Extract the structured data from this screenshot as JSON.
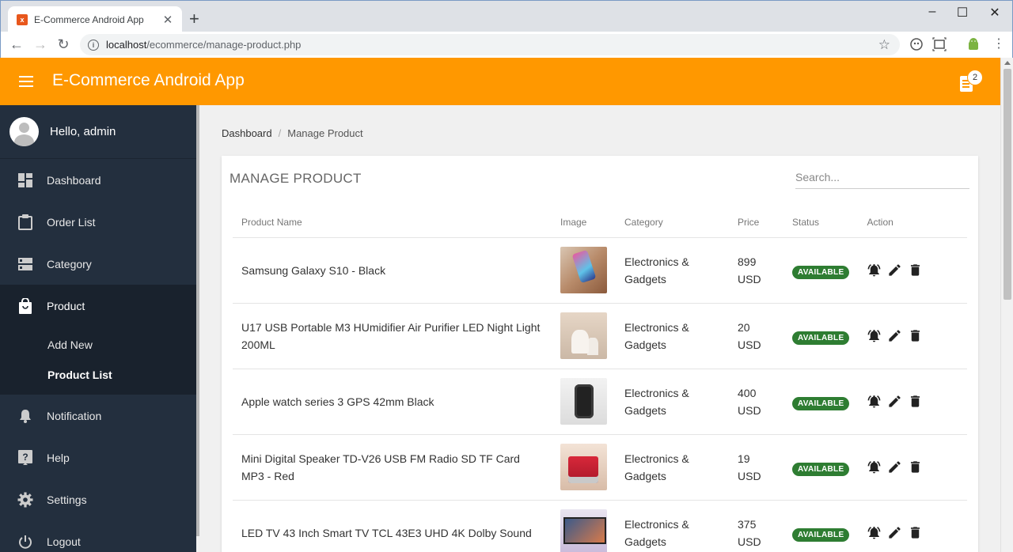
{
  "browser": {
    "tab_title": "E-Commerce Android App",
    "url_host": "localhost",
    "url_path": "/ecommerce/manage-product.php"
  },
  "header": {
    "title": "E-Commerce Android App",
    "notification_count": "2",
    "color": "#ff9800"
  },
  "sidebar": {
    "greeting": "Hello, admin",
    "items": [
      {
        "label": "Dashboard",
        "icon": "dashboard-icon"
      },
      {
        "label": "Order List",
        "icon": "clipboard-icon"
      },
      {
        "label": "Category",
        "icon": "category-icon"
      },
      {
        "label": "Product",
        "icon": "shopping-bag-icon"
      },
      {
        "label": "Notification",
        "icon": "bell-icon"
      },
      {
        "label": "Help",
        "icon": "help-icon"
      },
      {
        "label": "Settings",
        "icon": "gear-icon"
      },
      {
        "label": "Logout",
        "icon": "power-icon"
      }
    ],
    "submenu": [
      {
        "label": "Add New"
      },
      {
        "label": "Product List"
      }
    ],
    "background": "#232f3e"
  },
  "breadcrumb": {
    "root": "Dashboard",
    "separator": "/",
    "current": "Manage Product"
  },
  "card": {
    "title": "MANAGE PRODUCT",
    "search_placeholder": "Search..."
  },
  "table": {
    "headers": {
      "name": "Product Name",
      "image": "Image",
      "category": "Category",
      "price": "Price",
      "status": "Status",
      "action": "Action"
    },
    "rows": [
      {
        "name": "Samsung Galaxy S10 - Black",
        "image": "phone-thumbnail",
        "category_line1": "Electronics &",
        "category_line2": "Gadgets",
        "price_value": "899",
        "price_currency": "USD",
        "status": "AVAILABLE"
      },
      {
        "name": "U17 USB Portable M3 HUmidifier Air Purifier LED Night Light 200ML",
        "image": "humidifier-thumbnail",
        "category_line1": "Electronics &",
        "category_line2": "Gadgets",
        "price_value": "20",
        "price_currency": "USD",
        "status": "AVAILABLE"
      },
      {
        "name": "Apple watch series 3 GPS 42mm Black",
        "image": "watch-thumbnail",
        "category_line1": "Electronics &",
        "category_line2": "Gadgets",
        "price_value": "400",
        "price_currency": "USD",
        "status": "AVAILABLE"
      },
      {
        "name": "Mini Digital Speaker TD-V26 USB FM Radio SD TF Card MP3 - Red",
        "image": "speaker-thumbnail",
        "category_line1": "Electronics &",
        "category_line2": "Gadgets",
        "price_value": "19",
        "price_currency": "USD",
        "status": "AVAILABLE"
      },
      {
        "name": "LED TV 43 Inch Smart TV TCL 43E3 UHD 4K Dolby Sound",
        "image": "tv-thumbnail",
        "category_line1": "Electronics &",
        "category_line2": "Gadgets",
        "price_value": "375",
        "price_currency": "USD",
        "status": "AVAILABLE"
      }
    ],
    "status_color": "#2e7d32"
  }
}
